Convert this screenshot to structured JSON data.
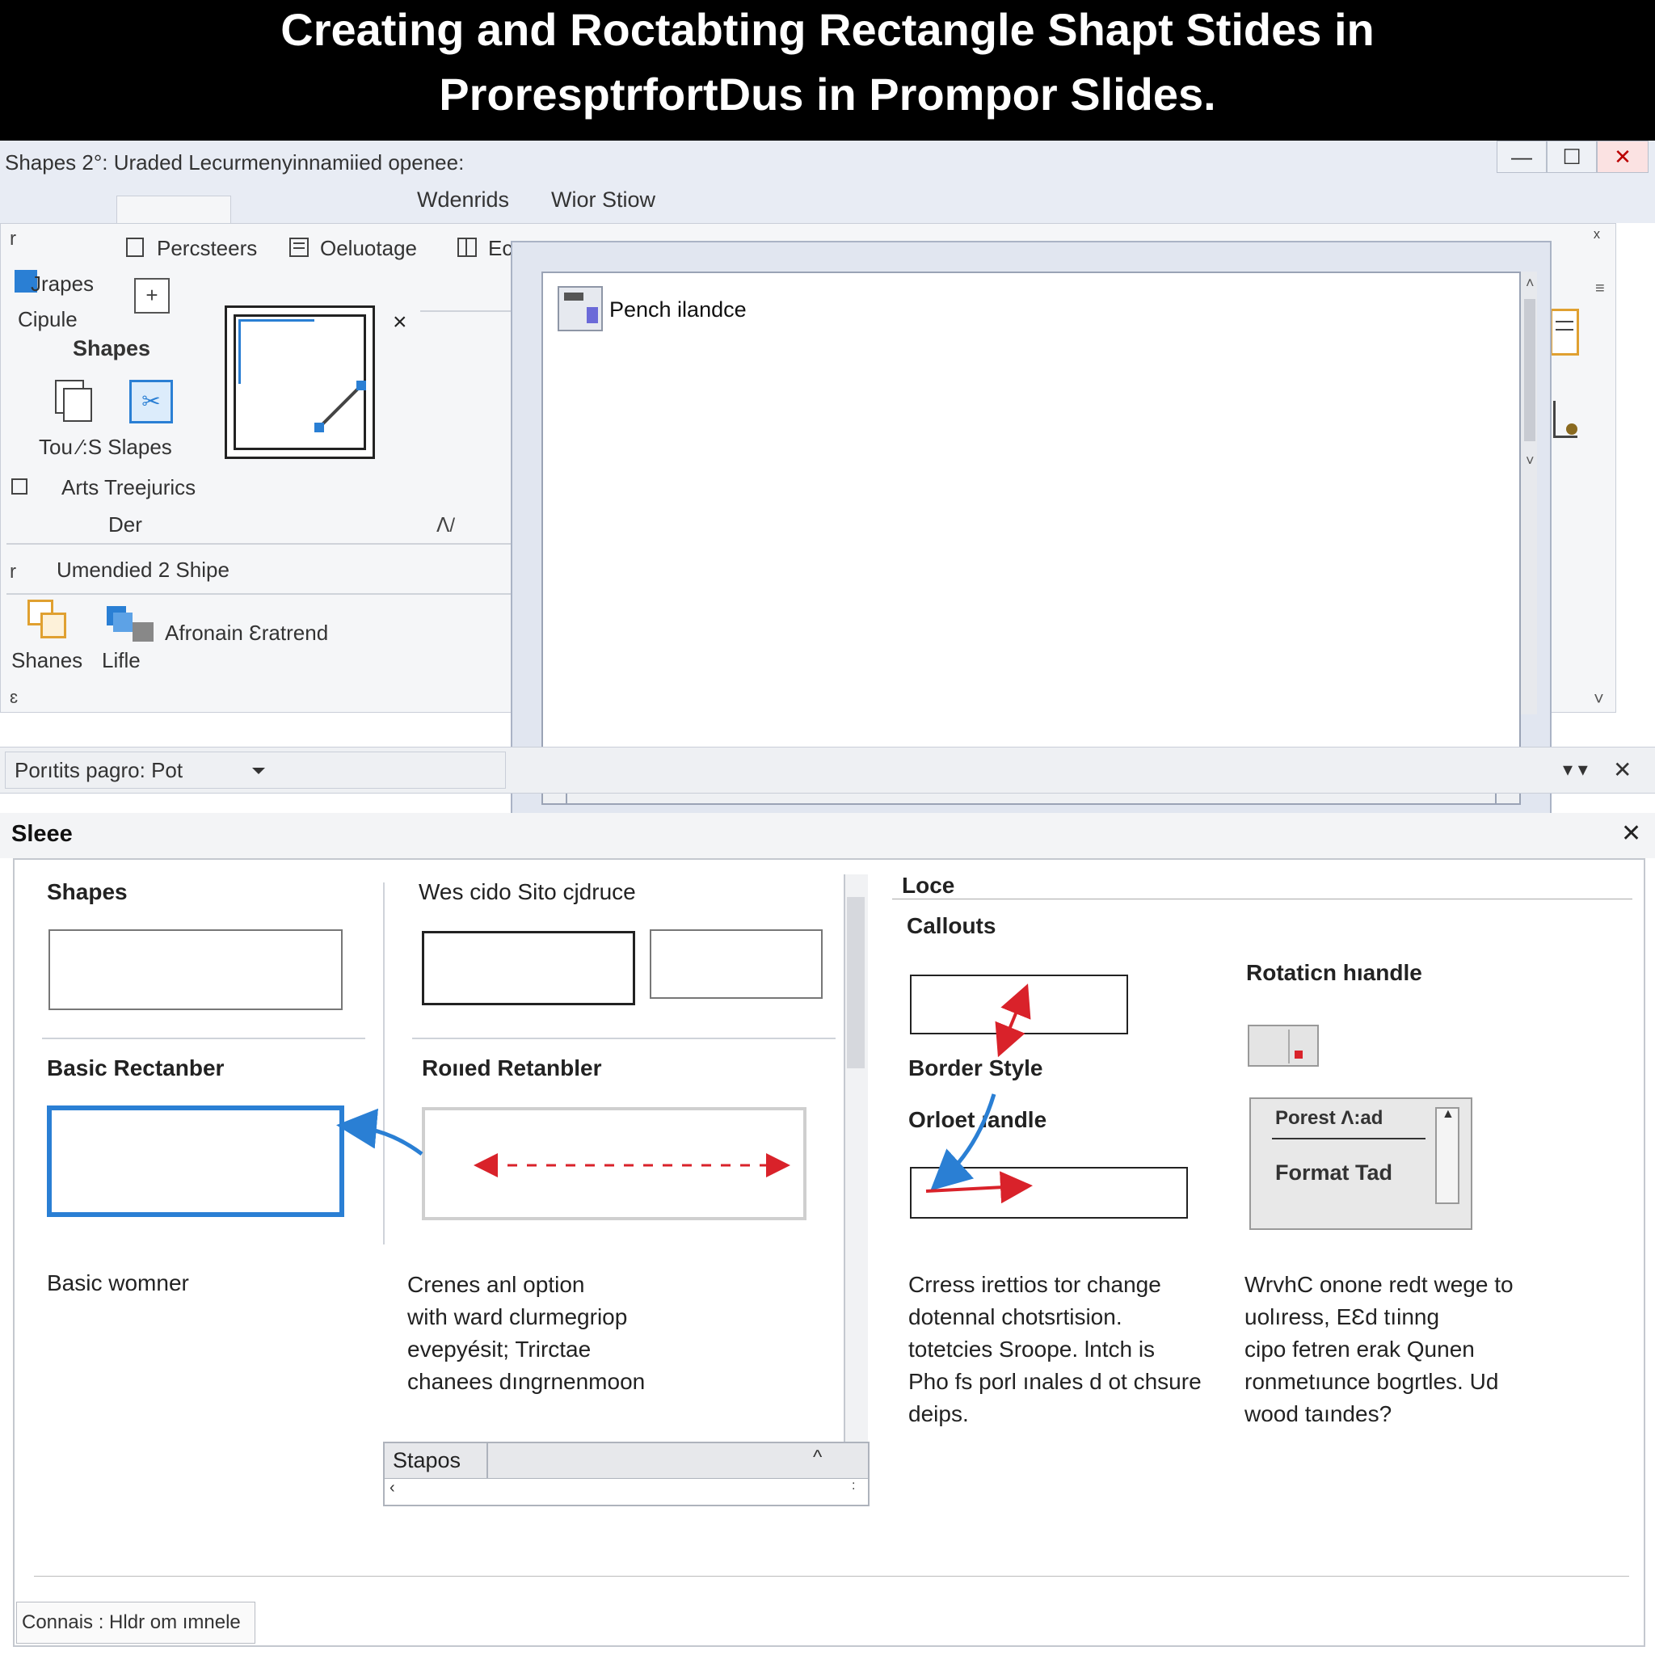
{
  "banner": {
    "line1": "Creating and Roctabting Rectangle Shapt Stides in",
    "line2": "ProresptrfortDus in Prompor Slides."
  },
  "window": {
    "title": "Shapes  2°: Uraded Lecurmenyinnamiied openee:",
    "controls": {
      "minimize": "—",
      "maximize": "☐",
      "close": "✕"
    }
  },
  "tabs": [
    "Wdenrids",
    "Wior Stiow"
  ],
  "ribbon": {
    "top_items": [
      "Percsteers",
      "Oeluotage",
      "Ec"
    ],
    "shapes_label": "Jrapes",
    "cipule_label": "Cipule",
    "shapes_group_label": "Shapes",
    "tou_label": "Tou ⁄:S Slapes",
    "arts_label": "Arts Treejurics",
    "der_label": "Der",
    "section2_label": "Umendied 2 Shipe",
    "shanes_label": "Shanes",
    "lifle_label": "Lifle",
    "afronain_label": "Afronain Ɛratrend",
    "close_mark": "×"
  },
  "dialog": {
    "item_label": "Pench ilandce"
  },
  "dropdown": {
    "value": "Porıtits pagro: Pot"
  },
  "panel": {
    "title": "Sleee",
    "close": "✕",
    "col1": {
      "heading": "Shapes",
      "basic_rect": "Basic Rectanber",
      "basic_caption": "Basic womner"
    },
    "col2": {
      "heading": "Wes cido Sito cjdruce",
      "rounded_rect": "Roııed Retanbler",
      "body": [
        "Crenes anl option",
        "with ward clurmegriop",
        "evepyésit; Trirctae",
        "chanees dıngrnenmoon"
      ],
      "subpanel_label": "Stapos"
    },
    "col3": {
      "heading": "Loce",
      "callouts": "Callouts",
      "border_style": "Border Style",
      "offset_handle": "Orloet ıandle",
      "body": [
        "Crress irettios tor change",
        "dotennal chotsrtision.",
        "totetcies  Sroope. lntch is",
        "Pho fs porl ınales d ot chsure",
        "deips."
      ]
    },
    "col4": {
      "rotation_handle": "Rotaticn hıandle",
      "format_top": "Porest  Ʌ:ad",
      "format_tad": "Format Tad",
      "body": [
        "WrvhC onone redt wege to",
        "uolıress, EƐd tıinng",
        "cipo fetren erak Qunen",
        "ronmetıunce bogrtles. Ud",
        "wood taındes?"
      ]
    }
  },
  "status": {
    "text": "Connais : Hldr om ımnele"
  },
  "colors": {
    "accent_blue": "#2a7fd4",
    "arrow_red": "#d9222a",
    "banner_bg": "#000000"
  },
  "icons": [
    "shapes-icon",
    "insert-shape-icon",
    "text-box-icon",
    "smartart-icon",
    "arrange-icon",
    "layers-icon",
    "scroll-up-icon",
    "scroll-down-icon",
    "dropdown-arrow-icon"
  ]
}
